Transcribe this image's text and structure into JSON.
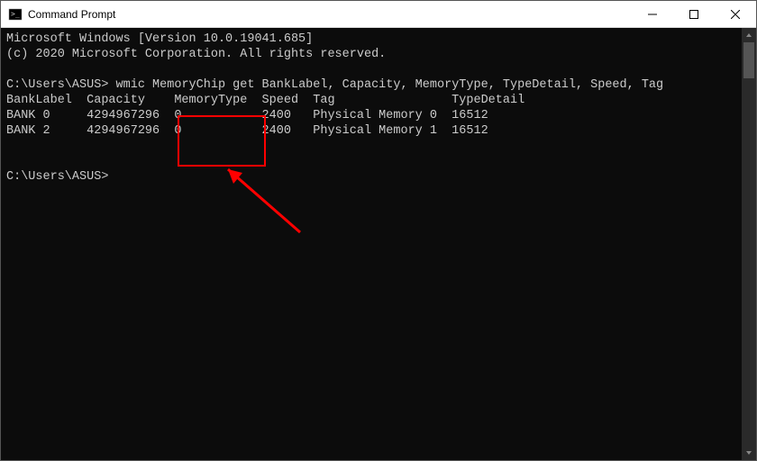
{
  "window": {
    "title": "Command Prompt"
  },
  "terminal": {
    "header_line1": "Microsoft Windows [Version 10.0.19041.685]",
    "header_line2": "(c) 2020 Microsoft Corporation. All rights reserved.",
    "prompt1_path": "C:\\Users\\ASUS>",
    "command1": "wmic MemoryChip get BankLabel, Capacity, MemoryType, TypeDetail, Speed, Tag",
    "columns_line": "BankLabel  Capacity    MemoryType  Speed  Tag                TypeDetail",
    "row1": "BANK 0     4294967296  0           2400   Physical Memory 0  16512",
    "row2": "BANK 2     4294967296  0           2400   Physical Memory 1  16512",
    "prompt2_path": "C:\\Users\\ASUS>"
  },
  "annotation": {
    "highlight_column": "MemoryType",
    "color": "#ff0000"
  }
}
